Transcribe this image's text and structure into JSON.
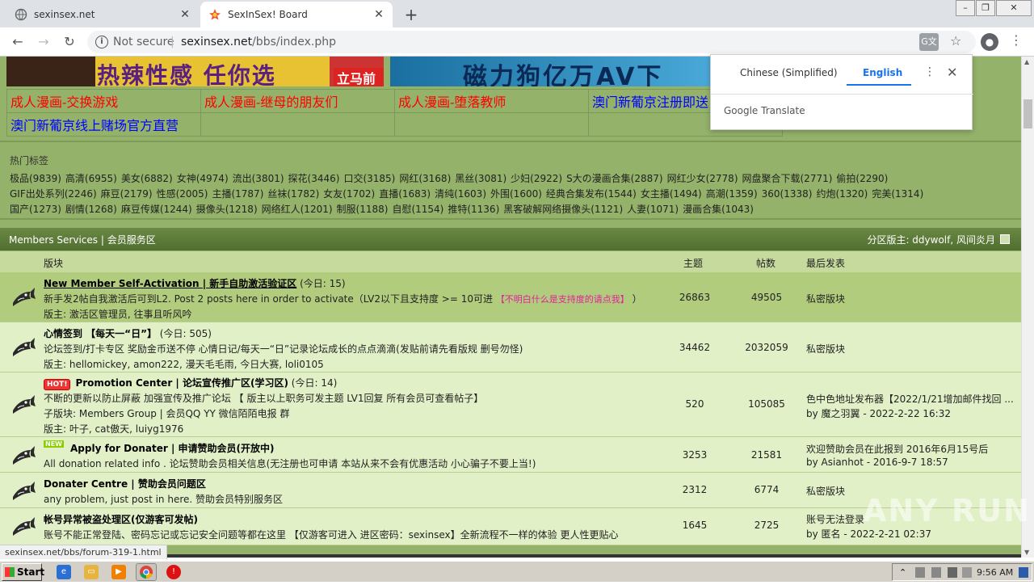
{
  "browser": {
    "tabs": [
      {
        "title": "sexinsex.net",
        "active": false
      },
      {
        "title": "SexInSex! Board",
        "active": true
      }
    ],
    "new_tab": "+",
    "not_secure": "Not secure",
    "url_host": "sexinsex.net",
    "url_path": "/bbs/index.php",
    "status_url": "sexinsex.net/bbs/forum-319-1.html"
  },
  "translate_popup": {
    "lang_from": "Chinese (Simplified)",
    "lang_to": "English",
    "brand": "Google Translate"
  },
  "banners": {
    "banner1_text": "热辣性感 任你选",
    "banner1_button": "立马前往",
    "banner2_text": "磁力狗亿万AV下"
  },
  "link_grid": [
    [
      {
        "text": "成人漫画-交换游戏",
        "color": "red"
      },
      {
        "text": "成人漫画-继母的朋友们",
        "color": "red"
      },
      {
        "text": "成人漫画-堕落教师",
        "color": "red"
      },
      {
        "text": "澳门新葡京注册即送",
        "color": "blue"
      }
    ],
    [
      {
        "text": "澳门新葡京线上赌场官方直营",
        "color": "blue"
      },
      {
        "text": "",
        "color": "blue"
      },
      {
        "text": "",
        "color": "blue"
      },
      {
        "text": "",
        "color": "blue"
      }
    ]
  ],
  "hot_tags": {
    "title": "热门标签",
    "rows": [
      [
        "极品(9839)",
        "高清(6955)",
        "美女(6882)",
        "女神(4974)",
        "流出(3801)",
        "探花(3446)",
        "口交(3185)",
        "网红(3168)",
        "黑丝(3081)",
        "少妇(2922)",
        "S大の漫画合集(2887)",
        "网红少女(2778)",
        "网盘聚合下载(2771)",
        "偷拍(2290)"
      ],
      [
        "GIF出处系列(2246)",
        "麻豆(2179)",
        "性感(2005)",
        "主播(1787)",
        "丝袜(1782)",
        "女友(1702)",
        "直播(1683)",
        "清纯(1603)",
        "外围(1600)",
        "经典合集发布(1544)",
        "女主播(1494)",
        "高潮(1359)",
        "360(1338)",
        "约炮(1320)",
        "完美(1314)"
      ],
      [
        "国产(1273)",
        "剧情(1268)",
        "麻豆传媒(1244)",
        "摄像头(1218)",
        "网络红人(1201)",
        "制服(1188)",
        "自慰(1154)",
        "推特(1136)",
        "黑客破解网络摄像头(1121)",
        "人妻(1071)",
        "漫画合集(1043)"
      ]
    ]
  },
  "section": {
    "title": "Members Services | 会员服务区",
    "moderators": "分区版主: ddywolf, 风间炎月"
  },
  "columns": {
    "forum": "版块",
    "topics": "主题",
    "posts": "帖数",
    "last_post": "最后发表"
  },
  "forums": [
    {
      "name": "New Member Self-Activation | 新手自助激活验证区",
      "today": "(今日: 15)",
      "desc": "新手发2帖自我激活后可到L2. Post 2 posts here in order to activate（LV2以下且支持度 >= 10可进",
      "desc_link": "【不明白什么是支持度的请点我】",
      "desc_end": "）",
      "extra": "",
      "mods": "版主: 激活区管理员, 往事且听风吟",
      "topics": "26863",
      "posts": "49505",
      "last1": "私密版块",
      "last2": "",
      "badge": ""
    },
    {
      "name": "心情签到 【每天一“日”】",
      "today": "(今日: 505)",
      "desc": "论坛签到/打卡专区 奖励金币送不停 心情日记/每天一“日”记录论坛成长的点点滴滴(发贴前请先看版规 删号勿怪)",
      "desc_link": "",
      "desc_end": "",
      "extra": "",
      "mods": "版主: hellomickey, amon222, 漫天毛毛雨, 今日大赛, loli0105",
      "topics": "34462",
      "posts": "2032059",
      "last1": "私密版块",
      "last2": "",
      "badge": ""
    },
    {
      "name": "Promotion Center | 论坛宣传推广区(学习区)",
      "today": "(今日: 14)",
      "desc": "不断的更新以防止屏蔽 加强宣传及推广论坛 【 版主以上职务可发主题 LV1回复 所有会员可查看帖子】",
      "desc_link": "",
      "desc_end": "",
      "extra": "子版块: Members Group | 会员QQ YY 微信陌陌电报 群",
      "mods": "版主: 叶子, cat傲天, luiyg1976",
      "topics": "520",
      "posts": "105085",
      "last1": "色中色地址发布器【2022/1/21增加邮件找回 ...",
      "last2": "by 魔之羽翼 - 2022-2-22 16:32",
      "badge": "HOT!"
    },
    {
      "name": "Apply for Donater | 申请赞助会员(开放中)",
      "today": "",
      "desc": "All donation related info . 论坛赞助会员相关信息(无注册也可申请 本站从来不会有优惠活动 小心骗子不要上当!)",
      "desc_link": "",
      "desc_end": "",
      "extra": "",
      "mods": "",
      "topics": "3253",
      "posts": "21581",
      "last1": "欢迎赞助会员在此报到 2016年6月15号后",
      "last2": "by Asianhot - 2016-9-7 18:57",
      "badge": "NEW"
    },
    {
      "name": "Donater Centre | 赞助会员问题区",
      "today": "",
      "desc": "any problem, just post in here.   赞助会员特别服务区",
      "desc_link": "",
      "desc_end": "",
      "extra": "",
      "mods": "",
      "topics": "2312",
      "posts": "6774",
      "last1": "私密版块",
      "last2": "",
      "badge": ""
    },
    {
      "name": "帐号异常被盗处理区(仅游客可发帖)",
      "today": "",
      "desc": "账号不能正常登陆、密码忘记或忘记安全问题等都在这里 【仅游客可进入 进区密码：sexinsex】全新流程不一样的体验 更人性更贴心",
      "desc_link": "",
      "desc_end": "",
      "extra": "",
      "mods": "",
      "topics": "1645",
      "posts": "2725",
      "last1": "账号无法登录",
      "last2": "by 匿名 - 2022-2-21 02:37",
      "badge": ""
    }
  ],
  "watermark": "ANY RUN",
  "taskbar": {
    "start": "Start",
    "clock": "9:56 AM"
  },
  "colors": {
    "page_bg": "#94b26a",
    "row_bg": "#e2f0c7",
    "row_hl": "#b2cc7e",
    "section_bg": "#5a7a38"
  }
}
